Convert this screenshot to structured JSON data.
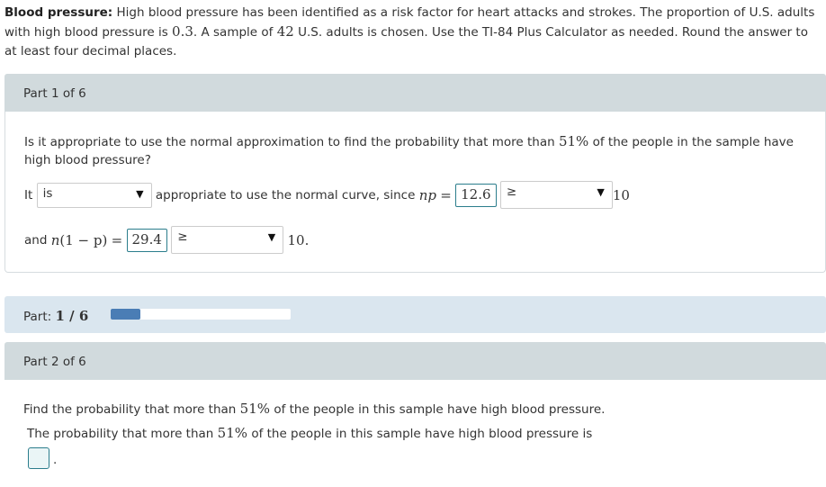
{
  "intro": {
    "label": "Blood pressure:",
    "text1": "High blood pressure has been identified as a risk factor for heart attacks and strokes. The proportion of U.S. adults with high blood pressure is",
    "p": "0.3",
    "text2": ". A sample of",
    "n": "42",
    "text3": "U.S. adults is chosen. Use the TI-84 Plus Calculator as needed. Round the answer to at least four decimal places."
  },
  "part1": {
    "header": "Part 1 of 6",
    "question_a": "Is it appropriate to use the normal approximation to find the probability that more than",
    "pct": "51%",
    "question_b": "of the people in the sample have high blood pressure?",
    "it": "It",
    "select1": "is",
    "text_mid": "appropriate to use the normal curve, since",
    "np_sym": "np",
    "eq": "=",
    "np_value": "12.6",
    "select2": "≥",
    "ten": "10",
    "and": "and",
    "n_sym": "n",
    "paren_expr": "(1 − p)",
    "nq_value": "29.4",
    "select3": "≥",
    "ten_end": "10."
  },
  "progress": {
    "label": "Part:",
    "value": "1 / 6",
    "fraction": 0.1667,
    "fill_color": "#4a7db5"
  },
  "part2": {
    "header": "Part 2 of 6",
    "question_a": "Find the probability that more than",
    "pct": "51%",
    "question_b": "of the people in this sample have high blood pressure.",
    "answer_a": "The probability that more than",
    "answer_b": "of the people in this sample have high blood pressure is",
    "answer_value": "",
    "end": "."
  }
}
